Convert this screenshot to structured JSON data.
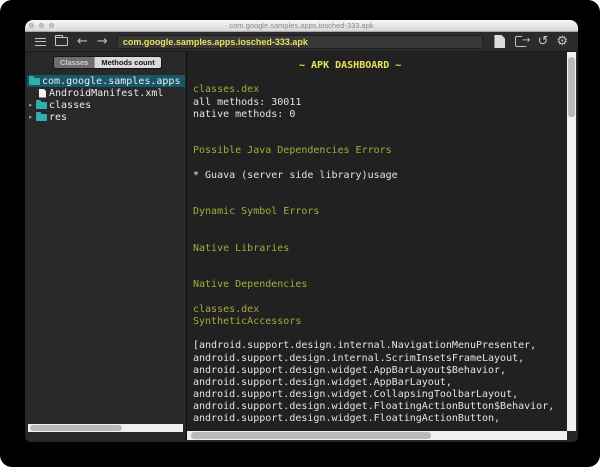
{
  "window": {
    "title": "com.google.samples.apps.iosched-333.apk"
  },
  "toolbar": {
    "path_value": "com.google.samples.apps.iosched-333.apk",
    "back_glyph": "←",
    "forward_glyph": "→",
    "history_glyph": "↺",
    "settings_glyph": "⚙"
  },
  "tabs": [
    {
      "label": "Classes",
      "selected": true
    },
    {
      "label": "Methods count",
      "selected": false
    }
  ],
  "sidebar": {
    "tree": [
      {
        "label": "com.google.samples.apps",
        "icon": "folder",
        "selected": true,
        "expandable": false,
        "indent": 0
      },
      {
        "label": "AndroidManifest.xml",
        "icon": "file",
        "selected": false,
        "expandable": false,
        "indent": 1
      },
      {
        "label": "classes",
        "icon": "folder",
        "selected": false,
        "expandable": true,
        "indent": 1
      },
      {
        "label": "res",
        "icon": "folder",
        "selected": false,
        "expandable": true,
        "indent": 1
      }
    ]
  },
  "glyphs": {
    "expand_arrow": "▸"
  },
  "console": {
    "lines": [
      {
        "kind": "title",
        "text": "~ APK DASHBOARD ~"
      },
      {
        "kind": "blank",
        "text": ""
      },
      {
        "kind": "header",
        "text": "classes.dex"
      },
      {
        "kind": "text",
        "text": "all methods: 30011"
      },
      {
        "kind": "text",
        "text": "native methods: 0"
      },
      {
        "kind": "blank",
        "text": ""
      },
      {
        "kind": "blank",
        "text": ""
      },
      {
        "kind": "header",
        "text": "Possible Java Dependencies Errors"
      },
      {
        "kind": "blank",
        "text": ""
      },
      {
        "kind": "text",
        "text": "* Guava (server side library)usage"
      },
      {
        "kind": "blank",
        "text": ""
      },
      {
        "kind": "blank",
        "text": ""
      },
      {
        "kind": "header",
        "text": "Dynamic Symbol Errors"
      },
      {
        "kind": "blank",
        "text": ""
      },
      {
        "kind": "blank",
        "text": ""
      },
      {
        "kind": "header",
        "text": "Native Libraries"
      },
      {
        "kind": "blank",
        "text": ""
      },
      {
        "kind": "blank",
        "text": ""
      },
      {
        "kind": "header",
        "text": "Native Dependencies"
      },
      {
        "kind": "blank",
        "text": ""
      },
      {
        "kind": "header",
        "text": "classes.dex"
      },
      {
        "kind": "header",
        "text": "SyntheticAccessors"
      },
      {
        "kind": "blank",
        "text": ""
      },
      {
        "kind": "text",
        "text": "[android.support.design.internal.NavigationMenuPresenter,"
      },
      {
        "kind": "text",
        "text": "android.support.design.internal.ScrimInsetsFrameLayout,"
      },
      {
        "kind": "text",
        "text": "android.support.design.widget.AppBarLayout$Behavior,"
      },
      {
        "kind": "text",
        "text": "android.support.design.widget.AppBarLayout,"
      },
      {
        "kind": "text",
        "text": "android.support.design.widget.CollapsingToolbarLayout,"
      },
      {
        "kind": "text",
        "text": "android.support.design.widget.FloatingActionButton$Behavior,"
      },
      {
        "kind": "text",
        "text": "android.support.design.widget.FloatingActionButton,"
      }
    ]
  },
  "colors": {
    "accent_yellow": "#e8e25a",
    "header_olive": "#a8a93b",
    "folder_teal": "#2cb1ad",
    "selection": "#17576a"
  }
}
